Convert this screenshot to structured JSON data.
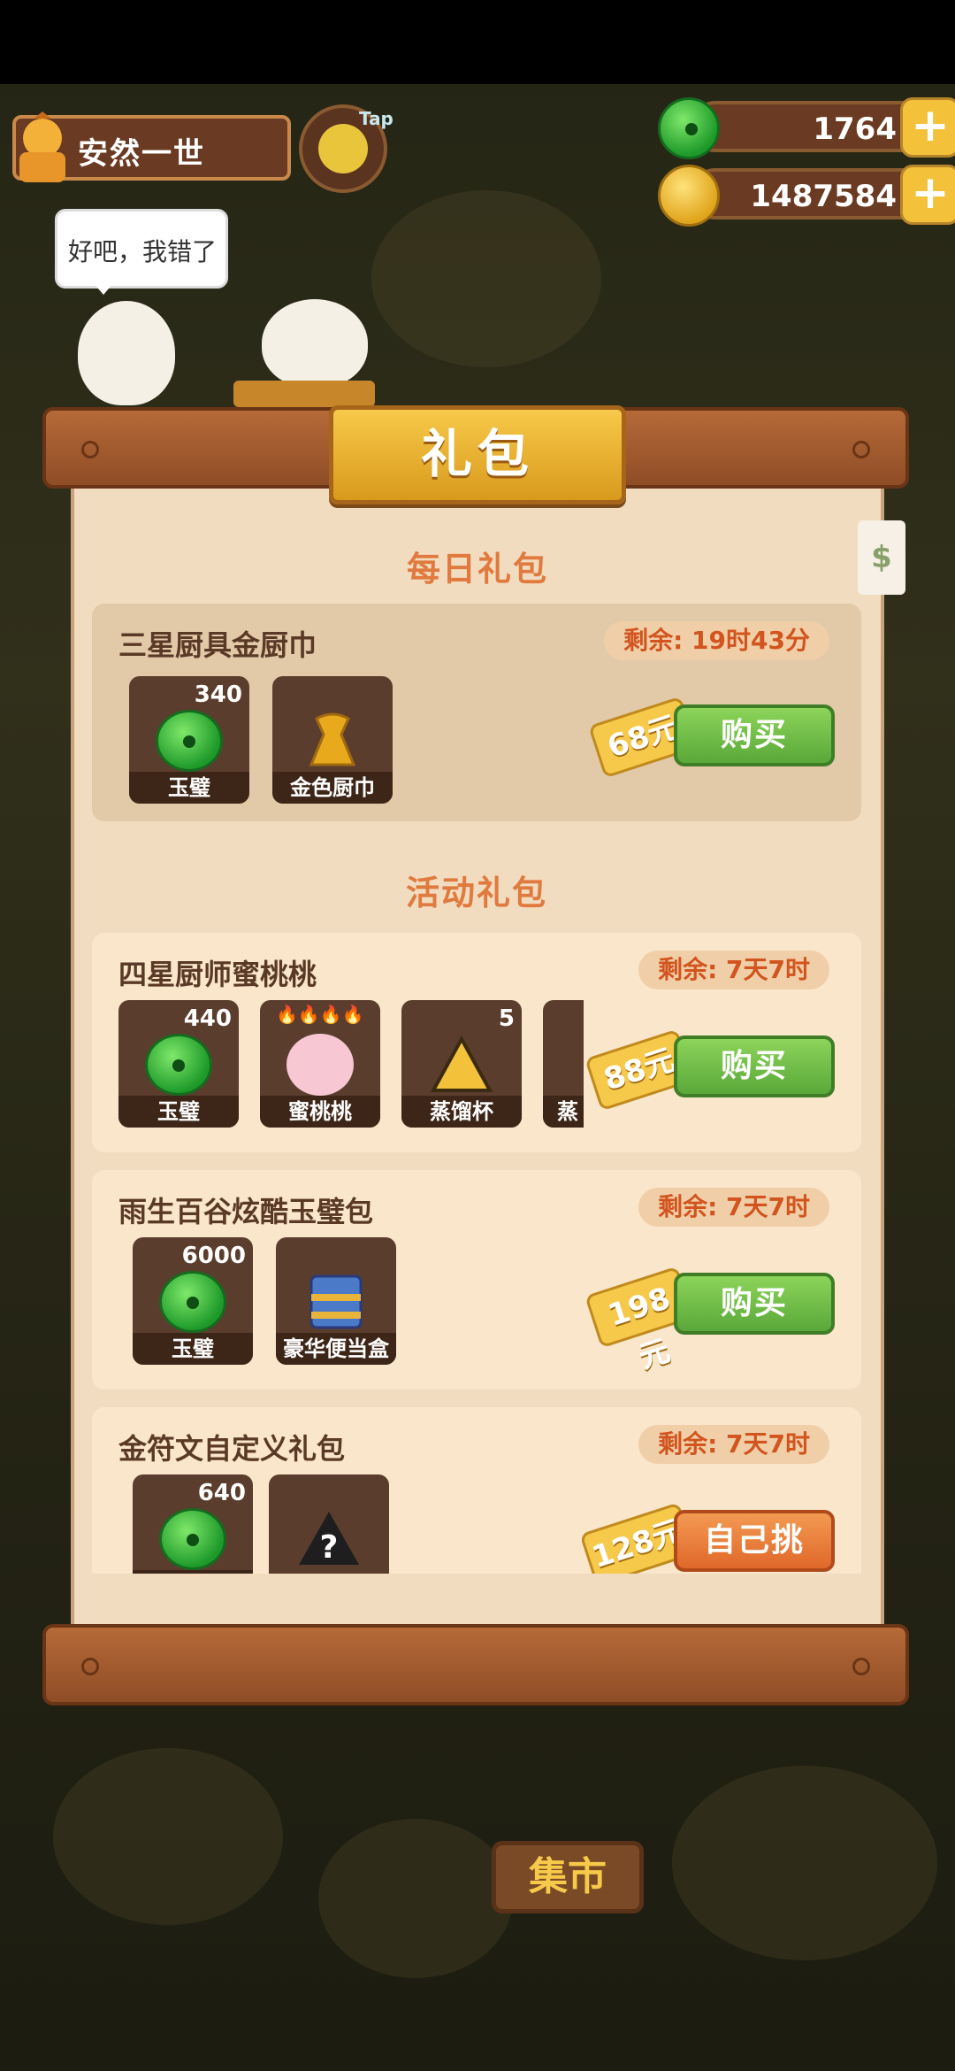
{
  "player": {
    "name": "安然一世"
  },
  "tap_label": "Tap",
  "resources": {
    "jade": "1764",
    "coins": "1487584"
  },
  "speech": "好吧，我错了",
  "panel": {
    "title": "礼包",
    "side_tab": "$"
  },
  "sections": {
    "daily": "每日礼包",
    "event": "活动礼包"
  },
  "packs": [
    {
      "title": "三星厨具金厨巾",
      "remaining": "剩余: 19时43分",
      "price": "68元",
      "button": "购买",
      "items": [
        {
          "label": "玉璧",
          "count": "340"
        },
        {
          "label": "金色厨巾",
          "count": ""
        }
      ]
    },
    {
      "title": "四星厨师蜜桃桃",
      "remaining": "剩余: 7天7时",
      "price": "88元",
      "button": "购买",
      "items": [
        {
          "label": "玉璧",
          "count": "440"
        },
        {
          "label": "蜜桃桃",
          "count": ""
        },
        {
          "label": "蒸馏杯",
          "count": "5"
        },
        {
          "label": "蒸",
          "count": ""
        }
      ]
    },
    {
      "title": "雨生百谷炫酷玉璧包",
      "remaining": "剩余: 7天7时",
      "price": "198元",
      "button": "购买",
      "items": [
        {
          "label": "玉璧",
          "count": "6000"
        },
        {
          "label": "豪华便当盒",
          "count": ""
        }
      ]
    },
    {
      "title": "金符文自定义礼包",
      "remaining": "剩余: 7天7时",
      "price": "128元",
      "button": "自己挑",
      "items": [
        {
          "label": "",
          "count": "640"
        },
        {
          "label": "",
          "count": ""
        }
      ]
    }
  ],
  "market": "集市",
  "colors": {
    "accent_orange": "#e07a3e",
    "buy_green": "#5aa83a",
    "countdown_red": "#d2541e"
  }
}
